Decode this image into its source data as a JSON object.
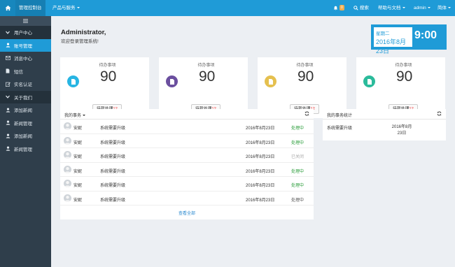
{
  "topbar": {
    "brand": "管理控制台",
    "products": "产品与服务",
    "notifications": "0",
    "search": "搜索",
    "help": "帮助与文档",
    "user": "admin",
    "lang": "简体"
  },
  "sidebar": {
    "items": [
      {
        "label": "用户中心"
      },
      {
        "label": "账号管理"
      },
      {
        "label": "消息中心"
      },
      {
        "label": "短信"
      },
      {
        "label": "实名认证"
      },
      {
        "label": "关于我们"
      },
      {
        "label": "添加新闻"
      },
      {
        "label": "新闻管理"
      },
      {
        "label": "添加新闻"
      },
      {
        "label": "新闻管理"
      }
    ]
  },
  "greeting": {
    "title": "Administrator,",
    "subtitle": "欢迎登录管理系统!"
  },
  "clock": {
    "weekday": "星期二",
    "date": "2016年8月23日",
    "time": "9:00"
  },
  "cards": [
    {
      "label": "待办事项",
      "value": "90",
      "btn_text": "待我处理",
      "btn_count": "12",
      "color": "#27b5e3"
    },
    {
      "label": "待办事项",
      "value": "90",
      "btn_text": "待我处理",
      "btn_count": "12",
      "color": "#6b4f9f"
    },
    {
      "label": "待办事项",
      "value": "90",
      "btn_text": "待我处理",
      "btn_count": "12",
      "color": "#e5c04f"
    },
    {
      "label": "待办事项",
      "value": "90",
      "btn_text": "待我处理",
      "btn_count": "12",
      "color": "#2bbb9b"
    }
  ],
  "tasks": {
    "title": "我的事务",
    "rows": [
      {
        "name": "安妮",
        "task": "系统需要升级",
        "date": "2016年8月23日",
        "status": "处理中",
        "status_color": "#2a9d3a"
      },
      {
        "name": "安妮",
        "task": "系统需要升级",
        "date": "2016年8月23日",
        "status": "处理中",
        "status_color": "#2a9d3a"
      },
      {
        "name": "安妮",
        "task": "系统需要升级",
        "date": "2016年8月23日",
        "status": "已关闭",
        "status_color": "#aaaaaa"
      },
      {
        "name": "安妮",
        "task": "系统需要升级",
        "date": "2016年8月23日",
        "status": "处理中",
        "status_color": "#2a9d3a"
      },
      {
        "name": "安妮",
        "task": "系统需要升级",
        "date": "2016年8月23日",
        "status": "处理中",
        "status_color": "#2a9d3a"
      },
      {
        "name": "安妮",
        "task": "系统需要升级",
        "date": "2016年8月23日",
        "status": "处理中",
        "status_color": "#555555"
      }
    ],
    "view_all": "查看全部"
  },
  "stats": {
    "title": "我的事务统计",
    "row": {
      "task": "系统需要升级",
      "date_line1": "2016年8月",
      "date_line2": "23日"
    }
  }
}
